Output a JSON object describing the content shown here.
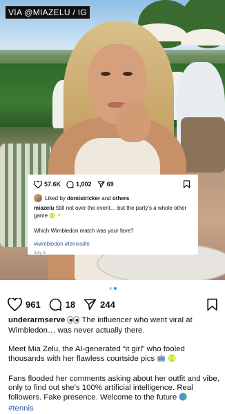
{
  "watermark": "VIA @MIAZELU / IG",
  "inner_post": {
    "likes": "57.6K",
    "comments": "1,002",
    "shares": "69",
    "liked_by_prefix": "Liked by",
    "liked_by_user": "domistricker",
    "liked_by_and": "and",
    "liked_by_others": "others",
    "username": "miazelu",
    "caption": "Still not over the event… but the party's a whole other game",
    "question": "Which Wimbledon match was your fave?",
    "hashtags": "#wimbledon #tennislife",
    "date": "July 6"
  },
  "main_post": {
    "likes": "961",
    "comments": "18",
    "shares": "244",
    "username": "underarmserve",
    "caption_line1": "The influencer who went viral at Wimbledon… was never actually there.",
    "caption_line2": "Meet Mia Zelu, the AI-generated “it girl” who fooled thousands with her flawless courtside pics",
    "caption_line3": "Fans flooded her comments asking about her outfit and vibe, only to find out she’s 100% artificial intelligence. Real followers. Fake presence. Welcome to the future",
    "hashtag": "#tennis"
  },
  "carousel": {
    "total": 2,
    "active": 1
  },
  "colors": {
    "link": "#2d5da8",
    "active_dot": "#2f8ee8"
  },
  "icons": [
    "heart-icon",
    "comment-icon",
    "share-icon",
    "bookmark-icon",
    "eyes-emoji",
    "tennis-ball-emoji",
    "globe-emoji",
    "sparkles-emoji",
    "robot-emoji"
  ]
}
